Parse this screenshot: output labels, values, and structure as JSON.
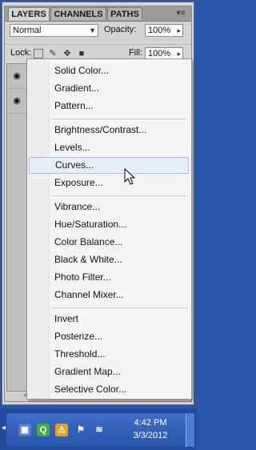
{
  "panel": {
    "tabs": [
      "LAYERS",
      "CHANNELS",
      "PATHS"
    ],
    "menu_icon": "panel-menu-icon",
    "blend_mode": "Normal",
    "opacity_label": "Opacity:",
    "opacity_value": "100%",
    "lock_label": "Lock:",
    "fill_label": "Fill:",
    "fill_value": "100%"
  },
  "menu": {
    "items": [
      "Solid Color...",
      "Gradient...",
      "Pattern...",
      "Brightness/Contrast...",
      "Levels...",
      "Curves...",
      "Exposure...",
      "Vibrance...",
      "Hue/Saturation...",
      "Color Balance...",
      "Black & White...",
      "Photo Filter...",
      "Channel Mixer...",
      "Invert",
      "Posterize...",
      "Threshold...",
      "Gradient Map...",
      "Selective Color..."
    ],
    "highlighted": "Curves..."
  },
  "taskbar": {
    "time": "4:42 PM",
    "date": "3/3/2012"
  }
}
